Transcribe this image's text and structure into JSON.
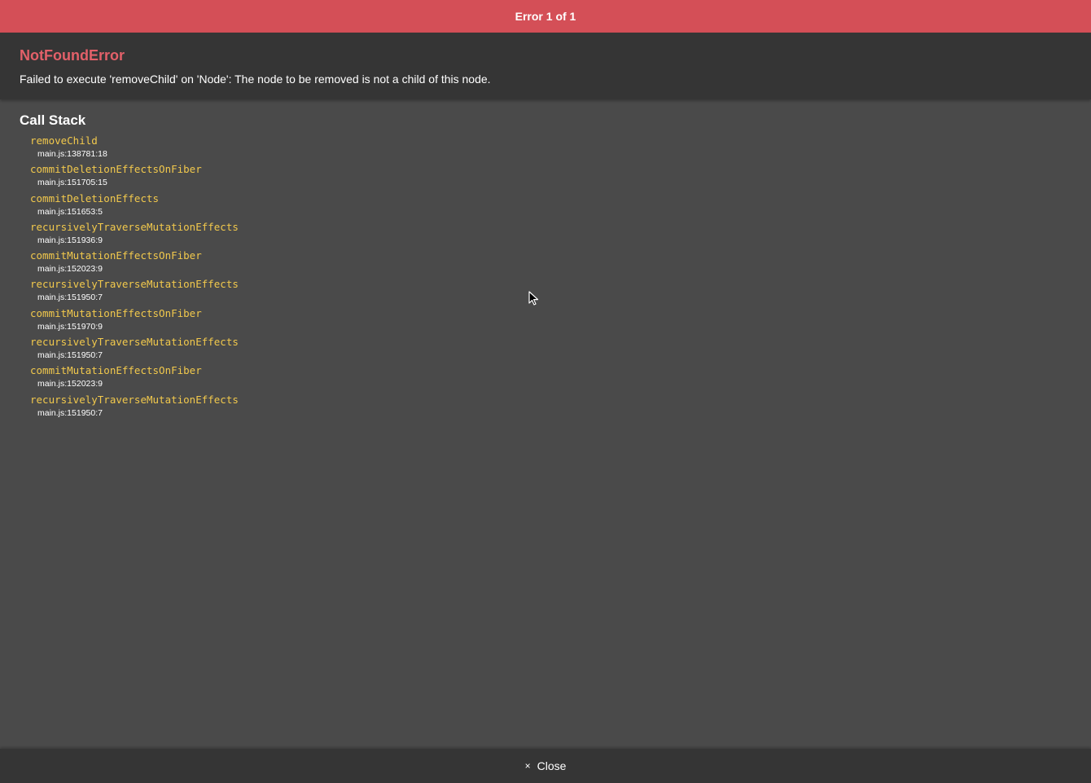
{
  "top_bar": {
    "title": "Error 1 of 1",
    "color": "#d44f57"
  },
  "error": {
    "name": "NotFoundError",
    "message": "Failed to execute 'removeChild' on 'Node': The node to be removed is not a child of this node.",
    "name_color": "#e36069"
  },
  "call_stack": {
    "title": "Call Stack",
    "function_color": "#f2c94c",
    "frames": [
      {
        "fn": "removeChild",
        "loc": "main.js:138781:18"
      },
      {
        "fn": "commitDeletionEffectsOnFiber",
        "loc": "main.js:151705:15"
      },
      {
        "fn": "commitDeletionEffects",
        "loc": "main.js:151653:5"
      },
      {
        "fn": "recursivelyTraverseMutationEffects",
        "loc": "main.js:151936:9"
      },
      {
        "fn": "commitMutationEffectsOnFiber",
        "loc": "main.js:152023:9"
      },
      {
        "fn": "recursivelyTraverseMutationEffects",
        "loc": "main.js:151950:7"
      },
      {
        "fn": "commitMutationEffectsOnFiber",
        "loc": "main.js:151970:9"
      },
      {
        "fn": "recursivelyTraverseMutationEffects",
        "loc": "main.js:151950:7"
      },
      {
        "fn": "commitMutationEffectsOnFiber",
        "loc": "main.js:152023:9"
      },
      {
        "fn": "recursivelyTraverseMutationEffects",
        "loc": "main.js:151950:7"
      }
    ]
  },
  "bottom_bar": {
    "close_icon": "×",
    "close_label": "Close"
  }
}
